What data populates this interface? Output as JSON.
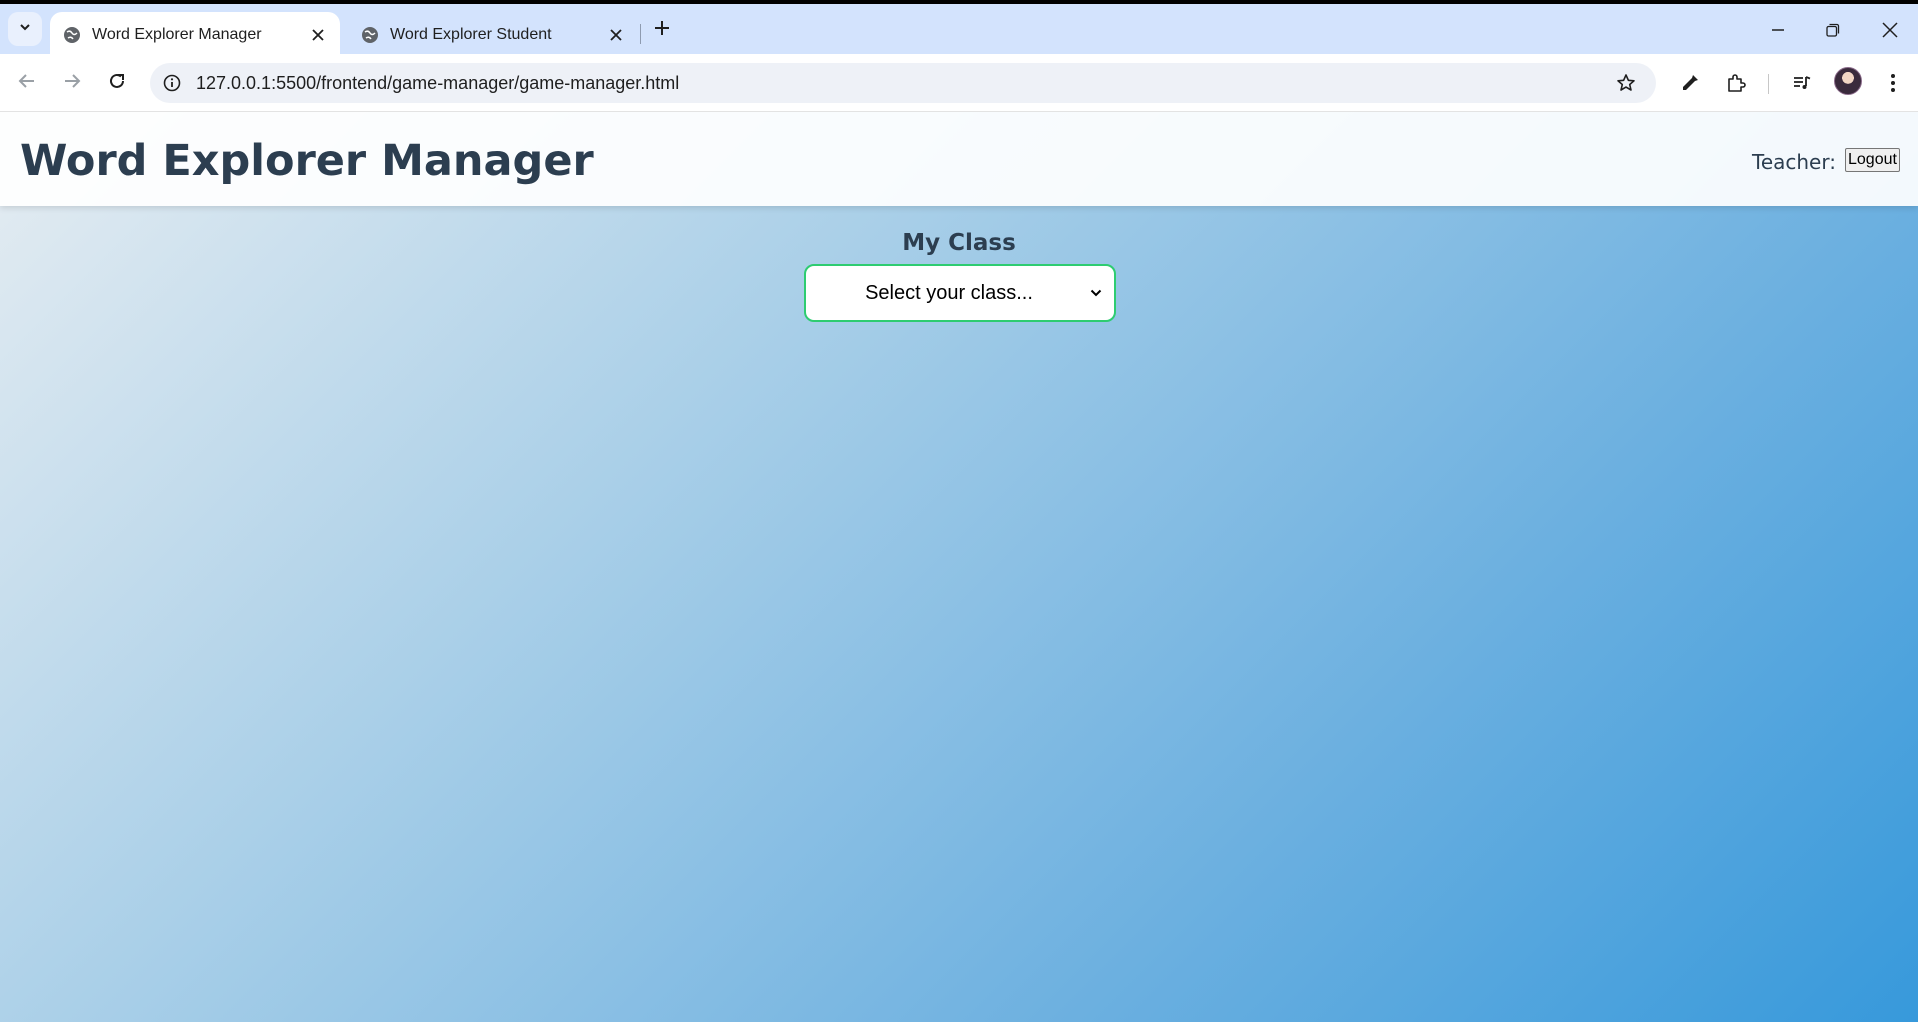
{
  "browser": {
    "tabs": [
      {
        "title": "Word Explorer Manager",
        "active": true
      },
      {
        "title": "Word Explorer Student",
        "active": false
      }
    ],
    "url": "127.0.0.1:5500/frontend/game-manager/game-manager.html"
  },
  "header": {
    "title": "Word Explorer Manager",
    "teacher_label": "Teacher:",
    "logout_label": "Logout"
  },
  "main": {
    "class_heading": "My Class",
    "class_select_value": "Select your class..."
  },
  "colors": {
    "title_text": "#2c3e50",
    "select_border": "#2ecc71",
    "gradient_start": "#e6edf2",
    "gradient_end": "#3799db",
    "tabstrip": "#d3e3fd"
  },
  "icons": [
    "tab-search-icon",
    "globe-icon",
    "close-icon",
    "plus-icon",
    "minimize-icon",
    "restore-icon",
    "back-icon",
    "forward-icon",
    "reload-icon",
    "site-info-icon",
    "star-icon",
    "eyedropper-icon",
    "extensions-icon",
    "media-control-icon",
    "kebab-menu-icon",
    "chevron-down-icon"
  ]
}
